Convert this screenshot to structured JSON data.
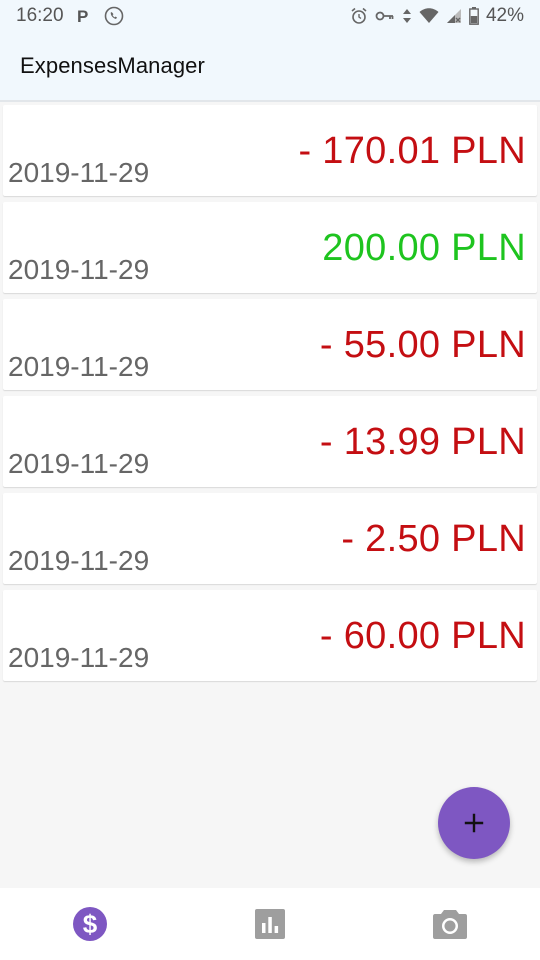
{
  "status_bar": {
    "time": "16:20",
    "battery": "42%",
    "left_icons": [
      "parking-icon",
      "call-icon"
    ],
    "right_icons": [
      "alarm-icon",
      "vpn-key-icon",
      "data-arrows-icon",
      "wifi-icon",
      "signal-icon",
      "battery-icon"
    ]
  },
  "app_bar": {
    "title": "ExpensesManager"
  },
  "transactions": [
    {
      "date": "2019-11-29",
      "amount": "- 170.01 PLN",
      "type": "expense"
    },
    {
      "date": "2019-11-29",
      "amount": "200.00 PLN",
      "type": "income"
    },
    {
      "date": "2019-11-29",
      "amount": "- 55.00 PLN",
      "type": "expense"
    },
    {
      "date": "2019-11-29",
      "amount": "- 13.99 PLN",
      "type": "expense"
    },
    {
      "date": "2019-11-29",
      "amount": "- 2.50 PLN",
      "type": "expense"
    },
    {
      "date": "2019-11-29",
      "amount": "- 60.00 PLN",
      "type": "expense"
    }
  ],
  "fab": {
    "icon": "plus-icon"
  },
  "bottom_nav": [
    {
      "icon": "dollar-icon",
      "active": true
    },
    {
      "icon": "bar-chart-icon",
      "active": false
    },
    {
      "icon": "camera-icon",
      "active": false
    }
  ],
  "colors": {
    "expense": "#c40e12",
    "income": "#1ec41f",
    "accent": "#7e57c2",
    "inactive_icon": "#9e9e9e"
  }
}
